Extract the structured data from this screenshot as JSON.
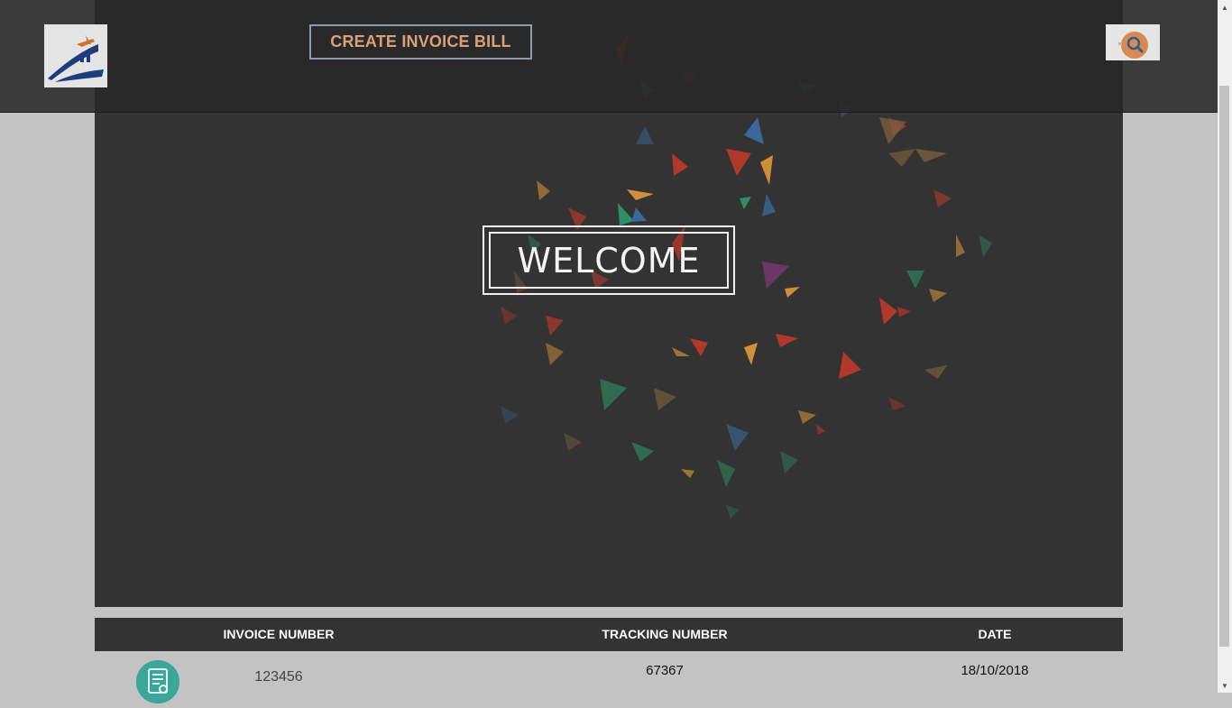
{
  "header": {
    "logo_icon": "ship-plane-logo-icon",
    "create_button_label": "CREATE INVOICE BILL",
    "search_icon": "search-icon"
  },
  "hero": {
    "welcome_text": "WELCOME"
  },
  "table": {
    "columns": [
      "INVOICE NUMBER",
      "TRACKING NUMBER",
      "DATE"
    ],
    "rows": [
      {
        "icon": "invoice-document-icon",
        "invoice_number": "123456",
        "tracking_number": "67367",
        "date": "18/10/2018"
      }
    ]
  },
  "colors": {
    "background": "#c3c3c3",
    "panel": "#333333",
    "accent": "#d9a07a",
    "row_icon": "#3aa79a"
  }
}
